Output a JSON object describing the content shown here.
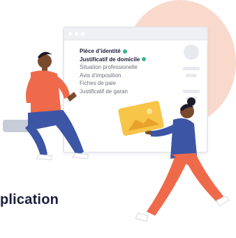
{
  "documents": {
    "items": [
      {
        "label": "Pièce d’identité",
        "status": "done"
      },
      {
        "label": "Justificatif de domicile",
        "status": "done"
      },
      {
        "label": "Situation professionelle",
        "status": "pending"
      },
      {
        "label": "Avis d’imposition",
        "status": "pending"
      },
      {
        "label": "Fiches de paie",
        "status": "pending"
      },
      {
        "label": "Justificatif de garan",
        "status": "pending"
      }
    ]
  },
  "page": {
    "heading": "plication"
  },
  "colors": {
    "check": "#3ab58f",
    "accent_circle": "#f9d9cc",
    "heading": "#1b1c3b"
  }
}
